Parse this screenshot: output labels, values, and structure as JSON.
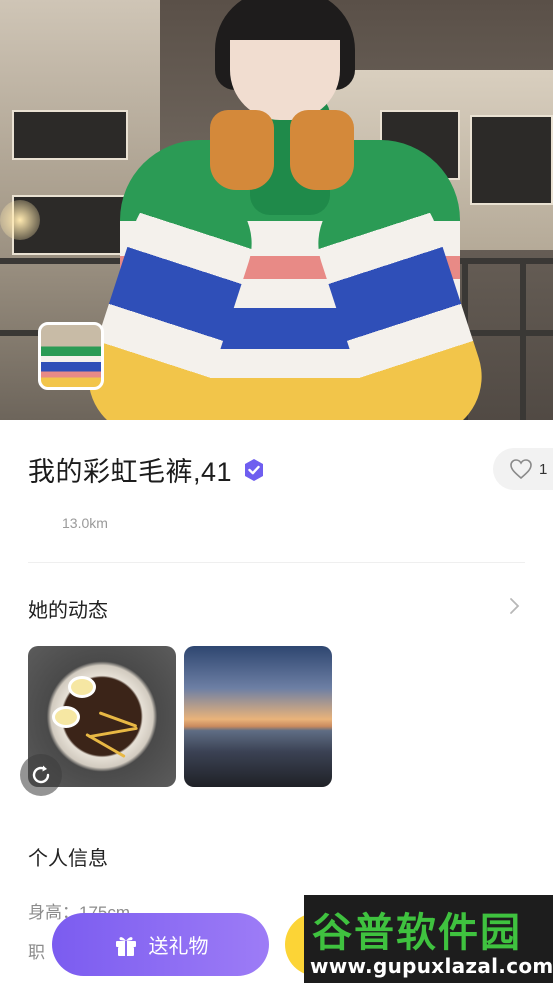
{
  "profile": {
    "name": "我的彩虹毛裤,41",
    "verified_icon": "verified-badge-icon",
    "distance": "13.0km",
    "like_count": "1",
    "like_icon": "heart-outline-icon"
  },
  "moments": {
    "title": "她的动态",
    "more_icon": "chevron-right-icon",
    "items": [
      {
        "icon": "noodle-photo"
      },
      {
        "icon": "sunset-photo"
      }
    ],
    "rotate_icon": "rotate-icon"
  },
  "personal_info": {
    "title": "个人信息",
    "height": "身高：175cm",
    "second_line": "职"
  },
  "actions": {
    "gift_label": "送礼物",
    "gift_icon": "gift-icon"
  },
  "watermark": {
    "logo": "谷普软件园",
    "url": "www.gupuxlazal.com"
  },
  "colors": {
    "accent": "#8a6cf2",
    "verified": "#6f5ef0",
    "chat_button": "#fcd436",
    "watermark_green": "#3fc23f"
  }
}
